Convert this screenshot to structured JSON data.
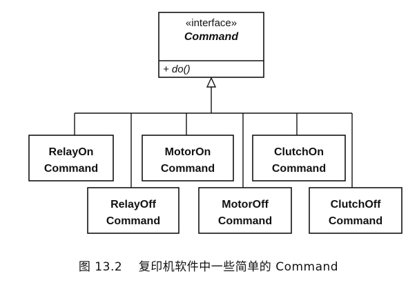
{
  "interface_box": {
    "stereotype": "«interface»",
    "name": "Command",
    "method": "+ do()"
  },
  "classes": [
    {
      "line1": "RelayOn",
      "line2": "Command"
    },
    {
      "line1": "MotorOn",
      "line2": "Command"
    },
    {
      "line1": "ClutchOn",
      "line2": "Command"
    },
    {
      "line1": "RelayOff",
      "line2": "Command"
    },
    {
      "line1": "MotorOff",
      "line2": "Command"
    },
    {
      "line1": "ClutchOff",
      "line2": "Command"
    }
  ],
  "caption": {
    "figure_number": "图 13.2",
    "text": "复印机软件中一些简单的 Command"
  }
}
